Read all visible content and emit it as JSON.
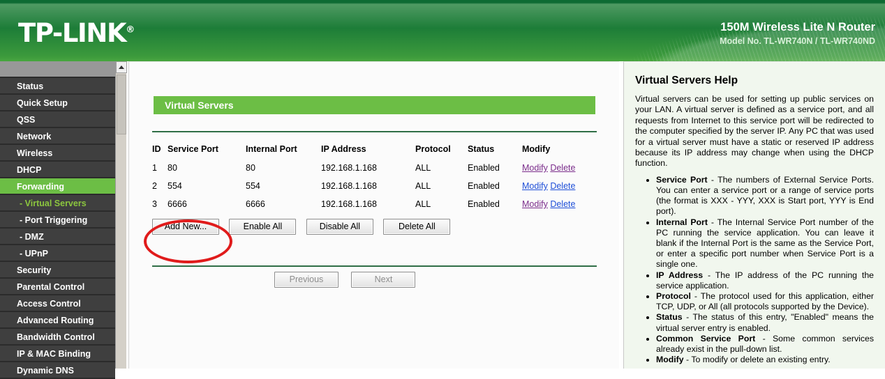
{
  "header": {
    "logo": "TP-LINK",
    "logo_reg": "®",
    "model_name": "150M Wireless Lite N Router",
    "model_no": "Model No. TL-WR740N / TL-WR740ND",
    "brand_green": "#6cbe45"
  },
  "sidebar": {
    "items": [
      {
        "label": "Status",
        "type": "top",
        "state": "normal"
      },
      {
        "label": "Quick Setup",
        "type": "top",
        "state": "normal"
      },
      {
        "label": "QSS",
        "type": "top",
        "state": "normal"
      },
      {
        "label": "Network",
        "type": "top",
        "state": "normal"
      },
      {
        "label": "Wireless",
        "type": "top",
        "state": "normal"
      },
      {
        "label": "DHCP",
        "type": "top",
        "state": "normal"
      },
      {
        "label": "Forwarding",
        "type": "top",
        "state": "active"
      },
      {
        "label": "- Virtual Servers",
        "type": "sub",
        "state": "current"
      },
      {
        "label": "- Port Triggering",
        "type": "sub",
        "state": "normal"
      },
      {
        "label": "- DMZ",
        "type": "sub",
        "state": "normal"
      },
      {
        "label": "- UPnP",
        "type": "sub",
        "state": "normal"
      },
      {
        "label": "Security",
        "type": "top",
        "state": "normal"
      },
      {
        "label": "Parental Control",
        "type": "top",
        "state": "normal"
      },
      {
        "label": "Access Control",
        "type": "top",
        "state": "normal"
      },
      {
        "label": "Advanced Routing",
        "type": "top",
        "state": "normal"
      },
      {
        "label": "Bandwidth Control",
        "type": "top",
        "state": "normal"
      },
      {
        "label": "IP & MAC Binding",
        "type": "top",
        "state": "normal"
      },
      {
        "label": "Dynamic DNS",
        "type": "top",
        "state": "normal"
      }
    ]
  },
  "main": {
    "panel_title": "Virtual Servers",
    "columns": [
      "ID",
      "Service Port",
      "Internal Port",
      "IP Address",
      "Protocol",
      "Status",
      "Modify"
    ],
    "rows": [
      {
        "id": "1",
        "service_port": "80",
        "internal_port": "80",
        "ip": "192.168.1.168",
        "protocol": "ALL",
        "status": "Enabled",
        "modify": "Modify",
        "delete": "Delete",
        "modify_visited": true,
        "delete_visited": true
      },
      {
        "id": "2",
        "service_port": "554",
        "internal_port": "554",
        "ip": "192.168.1.168",
        "protocol": "ALL",
        "status": "Enabled",
        "modify": "Modify",
        "delete": "Delete",
        "modify_visited": false,
        "delete_visited": false
      },
      {
        "id": "3",
        "service_port": "6666",
        "internal_port": "6666",
        "ip": "192.168.1.168",
        "protocol": "ALL",
        "status": "Enabled",
        "modify": "Modify",
        "delete": "Delete",
        "modify_visited": true,
        "delete_visited": false
      }
    ],
    "buttons": {
      "add_new": "Add New...",
      "enable_all": "Enable All",
      "disable_all": "Disable All",
      "delete_all": "Delete All",
      "previous": "Previous",
      "next": "Next"
    },
    "annotation_color": "#e01b1b"
  },
  "help": {
    "title": "Virtual Servers Help",
    "intro": "Virtual servers can be used for setting up public services on your LAN. A virtual server is defined as a service port, and all requests from Internet to this service port will be redirected to the computer specified by the server IP. Any PC that was used for a virtual server must have a static or reserved IP address because its IP address may change when using the DHCP function.",
    "bullets": [
      {
        "term": "Service Port",
        "text": " - The numbers of External Service Ports. You can enter a service port or a range of service ports (the format is XXX - YYY, XXX is Start port, YYY is End port)."
      },
      {
        "term": "Internal Port",
        "text": " - The Internal Service Port number of the PC running the service application. You can leave it blank if the Internal Port is the same as the Service Port, or enter a specific port number when Service Port is a single one."
      },
      {
        "term": "IP Address",
        "text": " - The IP address of the PC running the service application."
      },
      {
        "term": "Protocol",
        "text": " - The protocol used for this application, either TCP, UDP, or All (all protocols supported by the Device)."
      },
      {
        "term": "Status",
        "text": " - The status of this entry, \"Enabled\" means the virtual server entry is enabled."
      },
      {
        "term": "Common Service Port",
        "text": " - Some common services already exist in the pull-down list."
      },
      {
        "term": "Modify",
        "text": " - To modify or delete an existing entry."
      }
    ]
  }
}
